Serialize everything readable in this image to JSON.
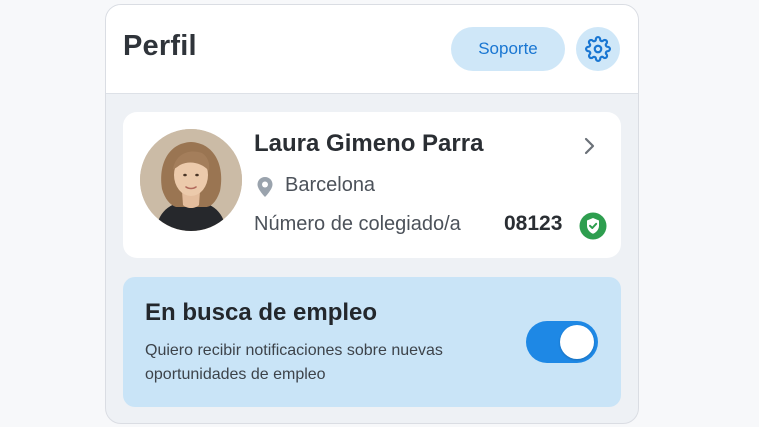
{
  "header": {
    "title": "Perfil",
    "support_label": "Soporte",
    "settings_icon": "gear-icon"
  },
  "profile": {
    "name": "Laura Gimeno Parra",
    "city": "Barcelona",
    "registration_label": "Número de colegiado/a",
    "registration_number": "08123",
    "verified": true
  },
  "job_search": {
    "title": "En busca de empleo",
    "description": "Quiero recibir notificaciones sobre nuevas oportunidades de empleo",
    "enabled": true
  },
  "colors": {
    "accent": "#1e88e5",
    "accent_light": "#cfe7f8",
    "job_card_bg": "#c9e4f7",
    "verified_green": "#2e9e4f"
  }
}
